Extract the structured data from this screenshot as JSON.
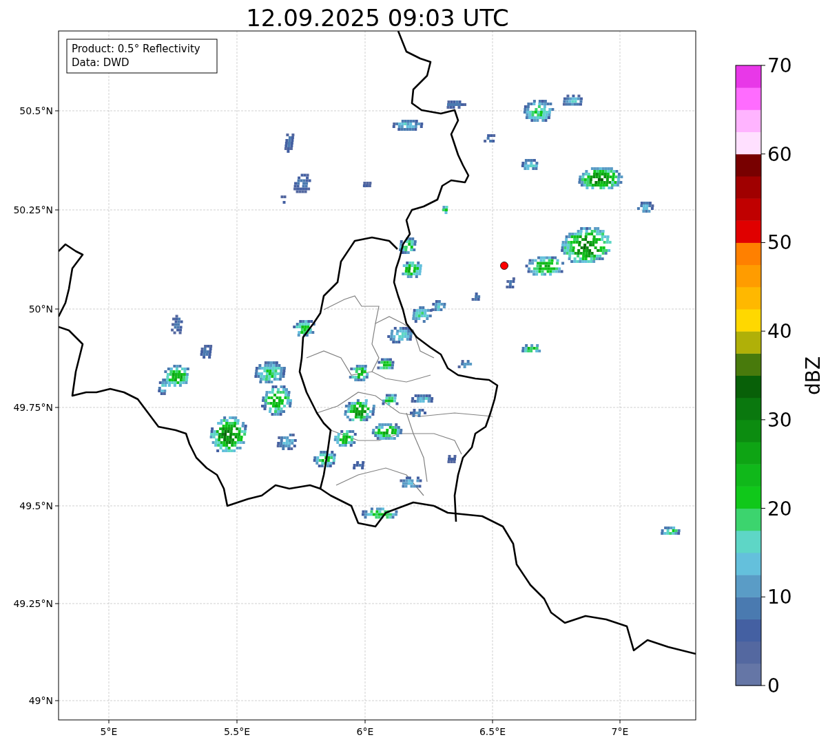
{
  "title": "12.09.2025 09:03 UTC",
  "legend": {
    "lines": [
      "Product: 0.5° Reflectivity",
      "Data: DWD"
    ]
  },
  "map": {
    "x_tick_labels": [
      "5°E",
      "5.5°E",
      "6°E",
      "6.5°E",
      "7°E"
    ],
    "y_tick_labels": [
      "50.5°N",
      "50.25°N",
      "50°N",
      "49.75°N",
      "49.5°N",
      "49.25°N",
      "49°N"
    ]
  },
  "colorbar": {
    "label": "dBZ",
    "ticks": [
      "70",
      "60",
      "50",
      "40",
      "30",
      "20",
      "10",
      "0"
    ],
    "bands": [
      {
        "color": "#6576a6"
      },
      {
        "color": "#5468a0"
      },
      {
        "color": "#4460a2"
      },
      {
        "color": "#4a7ab0"
      },
      {
        "color": "#5a9cc6"
      },
      {
        "color": "#64c0dc"
      },
      {
        "color": "#5ed6c6"
      },
      {
        "color": "#3cd46e"
      },
      {
        "color": "#10c81a"
      },
      {
        "color": "#10b81a"
      },
      {
        "color": "#0ea414"
      },
      {
        "color": "#0c8c10"
      },
      {
        "color": "#0a780e"
      },
      {
        "color": "#086008"
      },
      {
        "color": "#487a0c"
      },
      {
        "color": "#b0b008"
      },
      {
        "color": "#ffd800"
      },
      {
        "color": "#ffb800"
      },
      {
        "color": "#ff9c00"
      },
      {
        "color": "#ff8000"
      },
      {
        "color": "#e00000"
      },
      {
        "color": "#c00000"
      },
      {
        "color": "#a00000"
      },
      {
        "color": "#780000"
      },
      {
        "color": "#ffe0ff"
      },
      {
        "color": "#ffb4ff"
      },
      {
        "color": "#ff6cff"
      },
      {
        "color": "#e838e8"
      }
    ]
  }
}
